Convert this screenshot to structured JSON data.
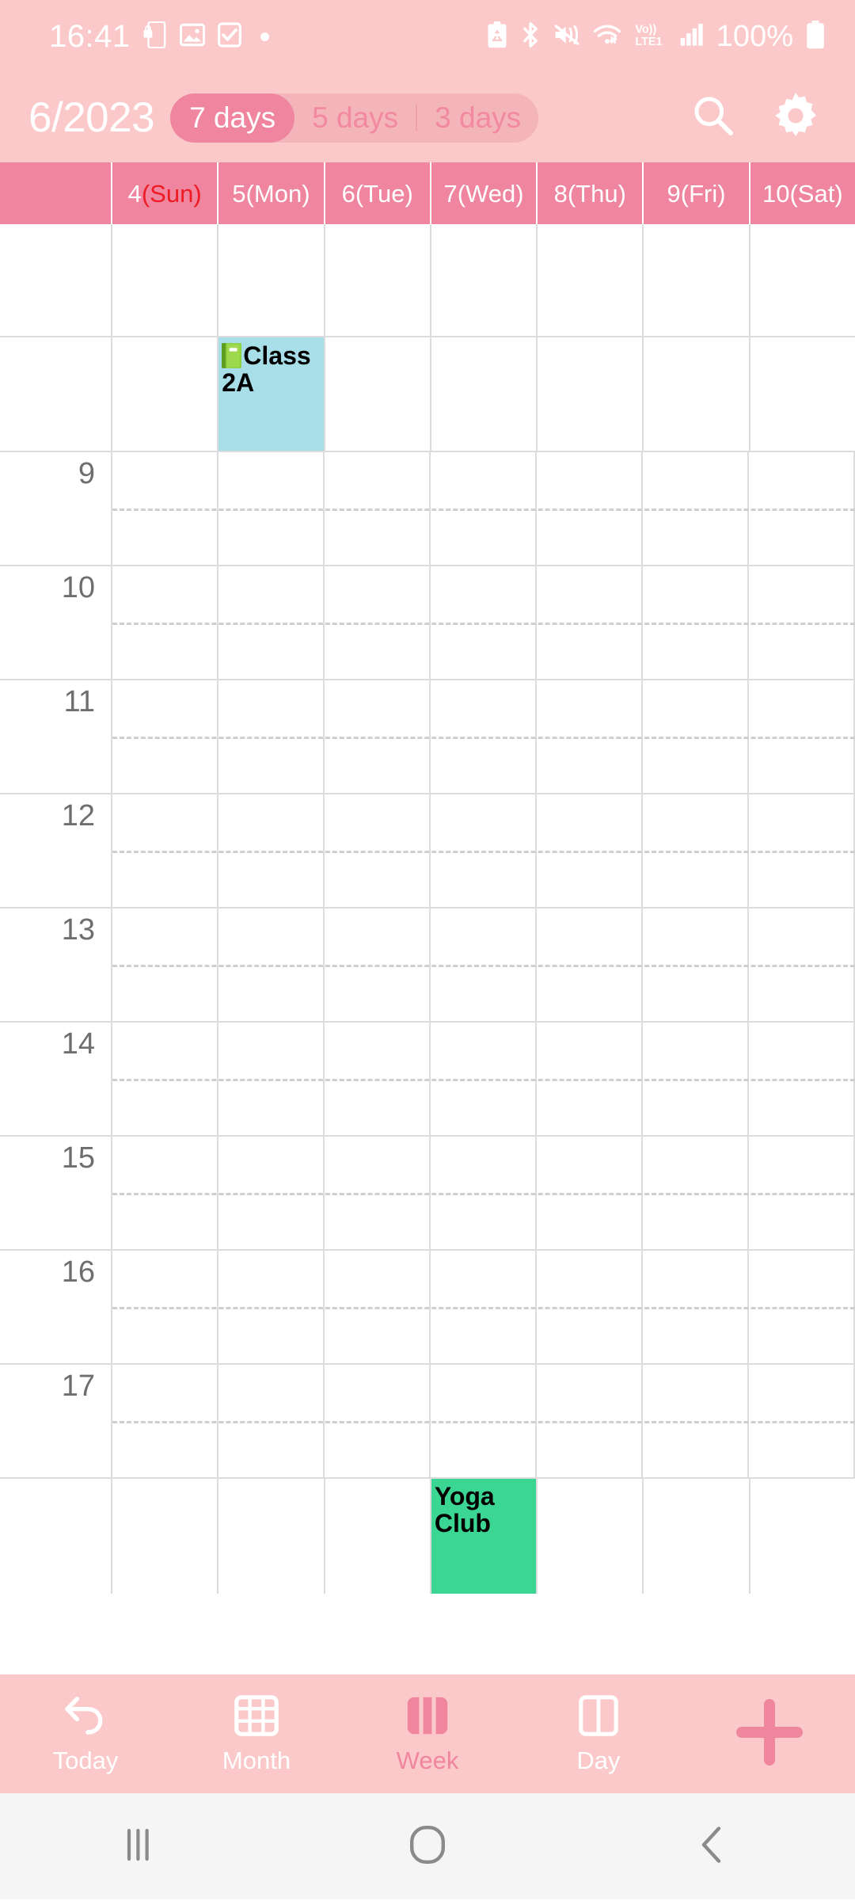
{
  "status_bar": {
    "time": "16:41",
    "battery_percent": "100%",
    "left_icons": [
      "phone-lock-icon",
      "image-icon",
      "checkbox-icon",
      "dot-indicator"
    ],
    "right_icons": [
      "battery-saver-icon",
      "bluetooth-icon",
      "mute-vibrate-icon",
      "wifi-icon",
      "volte-lte1-icon",
      "signal-bars-icon",
      "battery-icon"
    ],
    "volte_label": "Vo))",
    "lte_label": "LTE1"
  },
  "app_bar": {
    "title": "6/2023",
    "segments": [
      {
        "label": "7 days",
        "active": true
      },
      {
        "label": "5 days",
        "active": false
      },
      {
        "label": "3 days",
        "active": false
      }
    ],
    "actions": [
      "search-icon",
      "settings-gear-icon"
    ]
  },
  "calendar": {
    "day_headers": [
      {
        "num": "4",
        "dow": "(Sun)",
        "weekend": true
      },
      {
        "num": "5",
        "dow": "(Mon)",
        "weekend": false
      },
      {
        "num": "6",
        "dow": "(Tue)",
        "weekend": false
      },
      {
        "num": "7",
        "dow": "(Wed)",
        "weekend": false
      },
      {
        "num": "8",
        "dow": "(Thu)",
        "weekend": false
      },
      {
        "num": "9",
        "dow": "(Fri)",
        "weekend": false
      },
      {
        "num": "10",
        "dow": "(Sat)",
        "weekend": false
      }
    ],
    "hours": [
      "9",
      "10",
      "11",
      "12",
      "13",
      "14",
      "15",
      "16",
      "17"
    ],
    "events": [
      {
        "title": "Class 2A",
        "emoji": "book-green-icon",
        "day": "5(Mon)",
        "color": "#A8DEE8"
      },
      {
        "title": "Yoga Club",
        "emoji": "",
        "day": "7(Wed)",
        "color": "#3BD693"
      }
    ],
    "event_class2a_title": "Class 2A",
    "event_yoga_title": "Yoga Club"
  },
  "bottom_nav": {
    "items": [
      {
        "label": "Today",
        "icon": "undo-arrow-icon",
        "active": false
      },
      {
        "label": "Month",
        "icon": "month-grid-icon",
        "active": false
      },
      {
        "label": "Week",
        "icon": "week-columns-icon",
        "active": true
      },
      {
        "label": "Day",
        "icon": "day-split-icon",
        "active": false
      }
    ],
    "add_button": "plus-icon"
  },
  "system_nav": {
    "recents": "recents-icon",
    "home": "home-icon",
    "back": "back-icon"
  },
  "colors": {
    "header_pink": "#FBC9CA",
    "dayhead_pink": "#F0859F",
    "accent_pink": "#F0869E",
    "event_cyan": "#A8DEE8",
    "event_green": "#3BD693",
    "sunday_red": "#EE1B24"
  }
}
